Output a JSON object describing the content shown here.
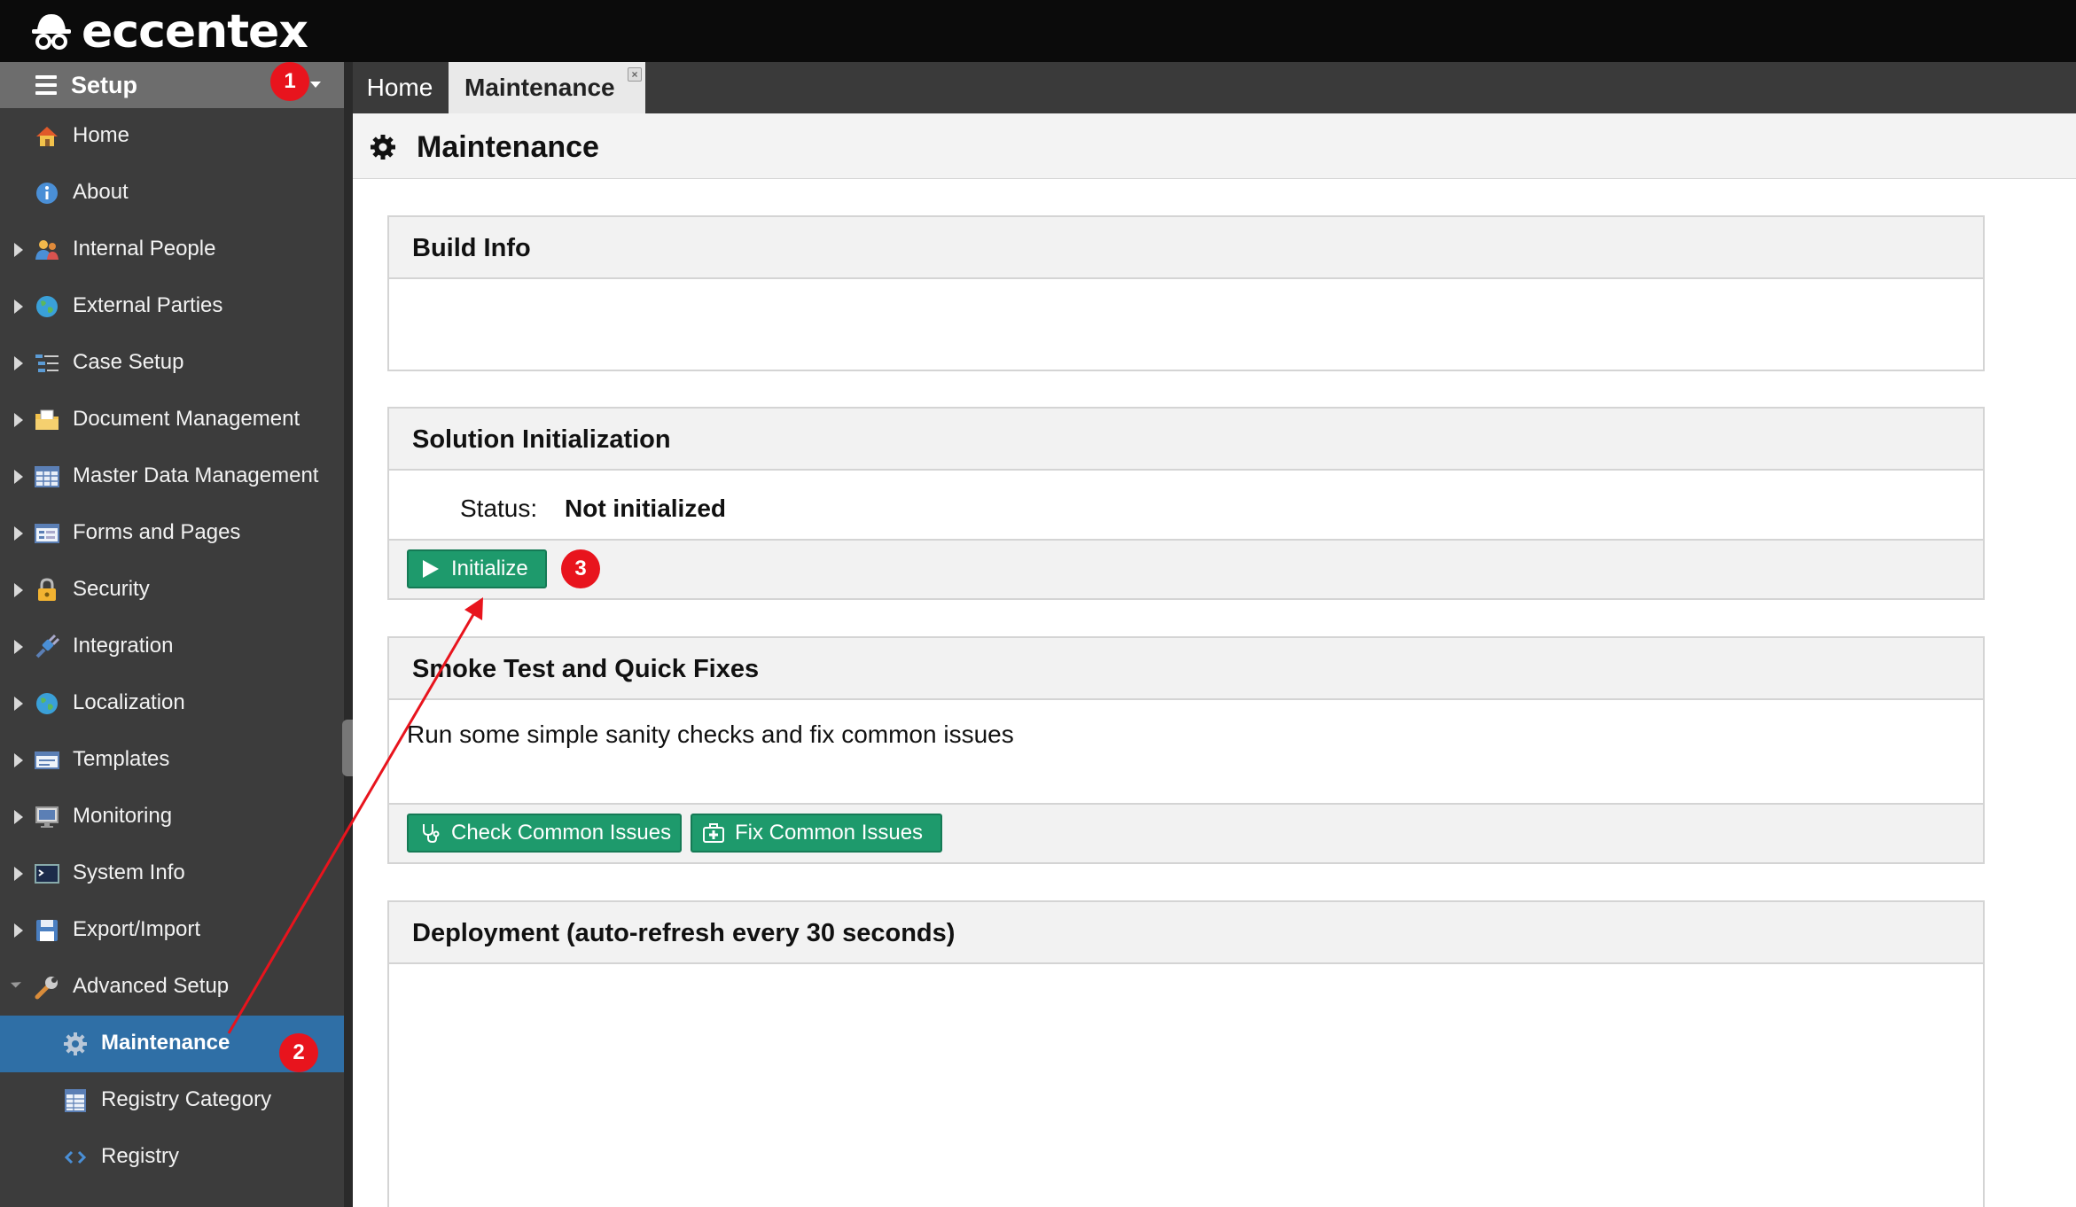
{
  "app": {
    "brand": "eccentex"
  },
  "sidebar": {
    "header": "Setup",
    "items": [
      {
        "label": "Home",
        "icon": "house-icon"
      },
      {
        "label": "About",
        "icon": "info-icon"
      },
      {
        "label": "Internal People",
        "icon": "people-icon"
      },
      {
        "label": "External Parties",
        "icon": "globe-icon"
      },
      {
        "label": "Case Setup",
        "icon": "case-setup-icon"
      },
      {
        "label": "Document Management",
        "icon": "folder-icon"
      },
      {
        "label": "Master Data Management",
        "icon": "table-icon"
      },
      {
        "label": "Forms and Pages",
        "icon": "form-icon"
      },
      {
        "label": "Security",
        "icon": "lock-icon"
      },
      {
        "label": "Integration",
        "icon": "plug-icon"
      },
      {
        "label": "Localization",
        "icon": "globe-icon"
      },
      {
        "label": "Templates",
        "icon": "template-icon"
      },
      {
        "label": "Monitoring",
        "icon": "monitor-icon"
      },
      {
        "label": "System Info",
        "icon": "terminal-icon"
      },
      {
        "label": "Export/Import",
        "icon": "floppy-icon"
      },
      {
        "label": "Advanced Setup",
        "icon": "wrench-icon"
      },
      {
        "label": "Maintenance",
        "icon": "gear-icon"
      },
      {
        "label": "Registry Category",
        "icon": "grid-icon"
      },
      {
        "label": "Registry",
        "icon": "code-icon"
      }
    ]
  },
  "tabs": [
    {
      "label": "Home"
    },
    {
      "label": "Maintenance"
    }
  ],
  "page": {
    "title": "Maintenance"
  },
  "panels": {
    "build_info": {
      "title": "Build Info"
    },
    "solution_init": {
      "title": "Solution Initialization",
      "status_label": "Status:",
      "status_value": "Not initialized",
      "initialize_button": "Initialize"
    },
    "smoke_test": {
      "title": "Smoke Test and Quick Fixes",
      "description": "Run some simple sanity checks and fix common issues",
      "check_button": "Check Common Issues",
      "fix_button": "Fix Common Issues"
    },
    "deployment": {
      "title": "Deployment (auto-refresh every 30 seconds)"
    }
  },
  "annotations": {
    "badge1": "1",
    "badge2": "2",
    "badge3": "3"
  },
  "colors": {
    "accent_green": "#1e9a6c",
    "active_blue": "#2f6fa6",
    "annotation_red": "#e8141d"
  }
}
